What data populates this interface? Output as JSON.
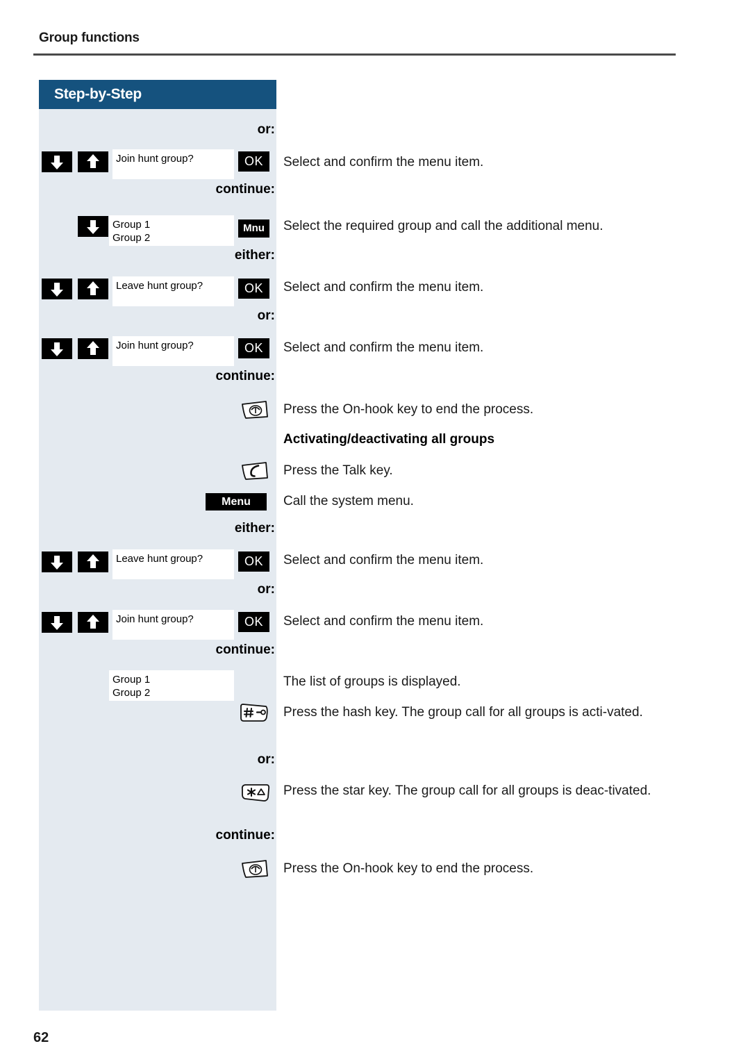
{
  "page": {
    "header_title": "Group functions",
    "folio": "62",
    "panel_title": "Step-by-Step",
    "colors": {
      "panel_bg": "#e4eaf0",
      "header_blue": "#15527e",
      "key_black": "#000000",
      "lcd_white": "#ffffff",
      "rule_gray": "#4a4a4a"
    }
  },
  "connectors": {
    "or": "or:",
    "either": "either:",
    "continue": "continue:"
  },
  "softkeys": {
    "ok": "OK",
    "mnu": "Mnu",
    "menu": "Menu"
  },
  "steps": [
    {
      "id": "join-hunt-group-1",
      "connector_above": "or:",
      "keys": [
        "down-arrow-key",
        "up-arrow-key"
      ],
      "lcd": [
        "Join hunt group?"
      ],
      "softkey": "OK",
      "explanation": "Select and confirm the menu item."
    },
    {
      "id": "select-group-mnu",
      "connector_above": "continue:",
      "keys": [
        "down-arrow-key"
      ],
      "lcd": [
        "Group 1",
        "Group 2"
      ],
      "softkey": "Mnu",
      "explanation": "Select the required group and call the additional menu."
    },
    {
      "id": "leave-hunt-group-1",
      "connector_above": "either:",
      "keys": [
        "down-arrow-key",
        "up-arrow-key"
      ],
      "lcd": [
        "Leave hunt group?"
      ],
      "softkey": "OK",
      "explanation": "Select and confirm the menu item."
    },
    {
      "id": "join-hunt-group-2",
      "connector_above": "or:",
      "keys": [
        "down-arrow-key",
        "up-arrow-key"
      ],
      "lcd": [
        "Join hunt group?"
      ],
      "softkey": "OK",
      "explanation": "Select and confirm the menu item."
    },
    {
      "id": "on-hook-1",
      "connector_above": "continue:",
      "keys": [
        "on-hook-key"
      ],
      "lcd": [],
      "softkey": "",
      "explanation": "Press the On-hook key to end the process."
    },
    {
      "id": "talk-key",
      "connector_above": "",
      "keys": [
        "talk-key"
      ],
      "lcd": [],
      "softkey": "",
      "explanation": "Press the Talk key."
    },
    {
      "id": "system-menu",
      "connector_above": "",
      "keys": [],
      "lcd": [],
      "softkey": "Menu",
      "explanation": "Call the system menu."
    },
    {
      "id": "leave-hunt-group-2",
      "connector_above": "either:",
      "keys": [
        "down-arrow-key",
        "up-arrow-key"
      ],
      "lcd": [
        "Leave hunt group?"
      ],
      "softkey": "OK",
      "explanation": "Select and confirm the menu item."
    },
    {
      "id": "join-hunt-group-3",
      "connector_above": "or:",
      "keys": [
        "down-arrow-key",
        "up-arrow-key"
      ],
      "lcd": [
        "Join hunt group?"
      ],
      "softkey": "OK",
      "explanation": "Select and confirm the menu item."
    },
    {
      "id": "group-list",
      "connector_above": "continue:",
      "keys": [],
      "lcd": [
        "Group 1",
        "Group 2"
      ],
      "softkey": "",
      "explanation": "The list of groups is displayed."
    },
    {
      "id": "hash-key",
      "connector_above": "",
      "keys": [
        "hash-key"
      ],
      "lcd": [],
      "softkey": "",
      "explanation": "Press the hash key. The group call for all groups is acti‑vated."
    },
    {
      "id": "star-key",
      "connector_above": "or:",
      "keys": [
        "star-key"
      ],
      "lcd": [],
      "softkey": "",
      "explanation": "Press the star key. The group call for all groups is deac‑tivated."
    },
    {
      "id": "on-hook-2",
      "connector_above": "continue:",
      "keys": [
        "on-hook-key"
      ],
      "lcd": [],
      "softkey": "",
      "explanation": "Press the On-hook key to end the process."
    }
  ],
  "section_heading": "Activating/deactivating all groups",
  "explanations": {
    "e1": "Select and confirm the menu item.",
    "e2": "Select the required group and call the additional menu.",
    "e3": "Select and confirm the menu item.",
    "e4": "Select and confirm the menu item.",
    "e5": "Press the On-hook key to end the process.",
    "e6": "Press the Talk key.",
    "e7": "Call the system menu.",
    "e8": "Select and confirm the menu item.",
    "e9": "Select and confirm the menu item.",
    "e10": "The list of groups is displayed.",
    "e11": "Press the hash key. The group call for all groups is acti‑vated.",
    "e12": "Press the star key. The group call for all groups is deac‑tivated.",
    "e13": "Press the On-hook key to end the process."
  },
  "lcd_text": {
    "join1": "Join hunt group?",
    "group_a1": "Group 1",
    "group_a2": "Group 2",
    "leave1": "Leave hunt group?",
    "join2": "Join hunt group?",
    "leave2": "Leave hunt group?",
    "join3": "Join hunt group?",
    "group_b1": "Group 1",
    "group_b2": "Group 2"
  }
}
